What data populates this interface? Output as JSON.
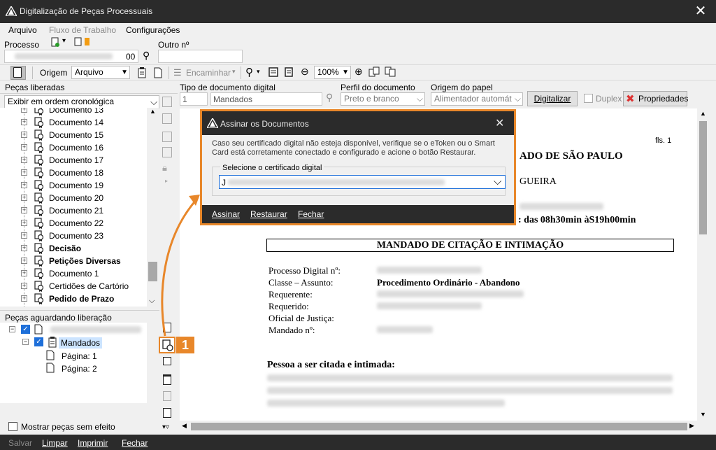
{
  "window": {
    "title": "Digitalização de Peças Processuais"
  },
  "menu": {
    "arquivo": "Arquivo",
    "fluxo": "Fluxo de Trabalho",
    "config": "Configurações"
  },
  "process": {
    "processo_label": "Processo",
    "outro_label": "Outro nº",
    "suffix": "00"
  },
  "toolbar": {
    "origem_label": "Origem",
    "origem_value": "Arquivo",
    "encaminhar": "Encaminhar",
    "zoom": "100%"
  },
  "left": {
    "pecas_liberadas": "Peças liberadas",
    "sort_value": "Exibir em ordem cronológica",
    "items": [
      {
        "label": "Documento 13",
        "bold": false
      },
      {
        "label": "Documento 14",
        "bold": false
      },
      {
        "label": "Documento 15",
        "bold": false
      },
      {
        "label": "Documento 16",
        "bold": false
      },
      {
        "label": "Documento 17",
        "bold": false
      },
      {
        "label": "Documento 18",
        "bold": false
      },
      {
        "label": "Documento 19",
        "bold": false
      },
      {
        "label": "Documento 20",
        "bold": false
      },
      {
        "label": "Documento 21",
        "bold": false
      },
      {
        "label": "Documento 22",
        "bold": false
      },
      {
        "label": "Documento 23",
        "bold": false
      },
      {
        "label": "Decisão",
        "bold": true
      },
      {
        "label": "Petições Diversas",
        "bold": true
      },
      {
        "label": "Documento 1",
        "bold": false
      },
      {
        "label": "Certidões de Cartório",
        "bold": false
      },
      {
        "label": "Pedido de Prazo",
        "bold": true
      }
    ],
    "aguardando": "Peças aguardando liberação",
    "mandados": "Mandados",
    "pagina1": "Página: 1",
    "pagina2": "Página: 2",
    "mostrar": "Mostrar peças sem efeito"
  },
  "docopts": {
    "tipo_label": "Tipo de documento digital",
    "tipo_code": "1",
    "tipo_value": "Mandados",
    "perfil_label": "Perfil do documento",
    "perfil_value": "Preto e branco",
    "origem_papel_label": "Origem do papel",
    "origem_papel_value": "Alimentador automát",
    "digitalizar": "Digitalizar",
    "duplex": "Duplex",
    "propriedades": "Propriedades"
  },
  "document": {
    "fls": "fls. 1",
    "header1": "ADO DE SÃO PAULO",
    "header2": "GUEIRA",
    "hours": ": das 08h30min àS19h00min",
    "title": "MANDADO DE CITAÇÃO E INTIMAÇÃO",
    "processo": "Processo Digital nº:",
    "classe": "Classe – Assunto:",
    "classe_value": "Procedimento Ordinário - Abandono",
    "requerente": "Requerente:",
    "requerido": "Requerido:",
    "oficial": "Oficial de Justiça:",
    "mandado": "Mandado nº:",
    "pessoa": "Pessoa a ser citada e intimada:"
  },
  "dialog": {
    "title": "Assinar os Documentos",
    "message": "Caso seu certificado digital não esteja disponível, verifique se o eToken ou o Smart Card está corretamente conectado e configurado e acione o botão Restaurar.",
    "group_label": "Selecione o certificado digital",
    "cert_prefix": "J",
    "assinar": "Assinar",
    "restaurar": "Restaurar",
    "fechar": "Fechar"
  },
  "callout": {
    "number": "1"
  },
  "status": {
    "salvar": "Salvar",
    "limpar": "Limpar",
    "imprimir": "Imprimir",
    "fechar": "Fechar"
  },
  "colors": {
    "accent": "#e8872a",
    "titlebar": "#2b2b2b",
    "check": "#1e6fd9"
  }
}
